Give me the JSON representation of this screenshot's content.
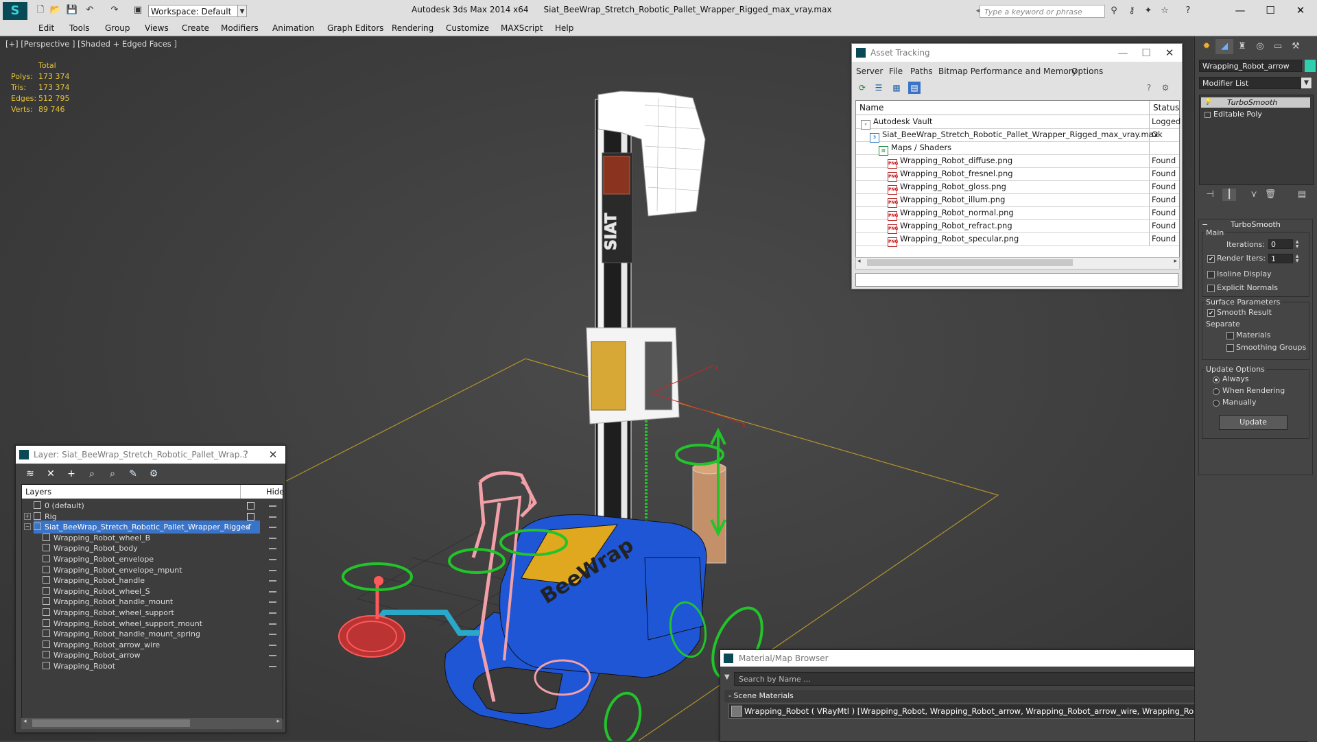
{
  "titlebar": {
    "app_name": "Autodesk 3ds Max  2014 x64",
    "file_name": "Siat_BeeWrap_Stretch_Robotic_Pallet_Wrapper_Rigged_max_vray.max",
    "workspace": "Workspace: Default",
    "search_placeholder": "Type a keyword or phrase",
    "minimize": "—",
    "maximize": "☐",
    "close": "✕"
  },
  "menu": [
    "Edit",
    "Tools",
    "Group",
    "Views",
    "Create",
    "Modifiers",
    "Animation",
    "Graph Editors",
    "Rendering",
    "Customize",
    "MAXScript",
    "Help"
  ],
  "viewport": {
    "label": "[+] [Perspective ] [Shaded + Edged Faces ]",
    "stats_header": "Total",
    "stats": [
      {
        "k": "Polys:",
        "v": "173 374"
      },
      {
        "k": "Tris:",
        "v": "173 374"
      },
      {
        "k": "Edges:",
        "v": "512 795"
      },
      {
        "k": "Verts:",
        "v": "89 746"
      }
    ],
    "brand_text": "BeeWrap",
    "brand_text_2": "SIAT",
    "axis_x": "x",
    "axis_y": "y"
  },
  "asset_tracking": {
    "title": "Asset Tracking",
    "menu": [
      "Server",
      "File",
      "Paths",
      "Bitmap Performance and Memory",
      "Options"
    ],
    "col_name": "Name",
    "col_status": "Status",
    "rows": [
      {
        "name": "Autodesk Vault",
        "status": "Logged",
        "indent": 1,
        "icon": "vault-icon"
      },
      {
        "name": "Siat_BeeWrap_Stretch_Robotic_Pallet_Wrapper_Rigged_max_vray.max",
        "status": "Ok",
        "indent": 2,
        "icon": "max-file-icon"
      },
      {
        "name": "Maps / Shaders",
        "status": "",
        "indent": 3,
        "icon": "maps-icon"
      },
      {
        "name": "Wrapping_Robot_diffuse.png",
        "status": "Found",
        "indent": 4,
        "icon": "png-icon"
      },
      {
        "name": "Wrapping_Robot_fresnel.png",
        "status": "Found",
        "indent": 4,
        "icon": "png-icon"
      },
      {
        "name": "Wrapping_Robot_gloss.png",
        "status": "Found",
        "indent": 4,
        "icon": "png-icon"
      },
      {
        "name": "Wrapping_Robot_illum.png",
        "status": "Found",
        "indent": 4,
        "icon": "png-icon"
      },
      {
        "name": "Wrapping_Robot_normal.png",
        "status": "Found",
        "indent": 4,
        "icon": "png-icon"
      },
      {
        "name": "Wrapping_Robot_refract.png",
        "status": "Found",
        "indent": 4,
        "icon": "png-icon"
      },
      {
        "name": "Wrapping_Robot_specular.png",
        "status": "Found",
        "indent": 4,
        "icon": "png-icon"
      }
    ],
    "png_badge": "PNG"
  },
  "layer_explorer": {
    "title": "Layer: Siat_BeeWrap_Stretch_Robotic_Pallet_Wrap...",
    "help": "?",
    "col_layers": "Layers",
    "col_hide": "Hide",
    "rows": [
      {
        "name": "0 (default)",
        "level": 0,
        "expander": "",
        "box": true,
        "selected": false
      },
      {
        "name": "Rig",
        "level": 0,
        "expander": "+",
        "box": true,
        "selected": false
      },
      {
        "name": "Siat_BeeWrap_Stretch_Robotic_Pallet_Wrapper_Rigged",
        "level": 0,
        "expander": "−",
        "box": false,
        "selected": true
      },
      {
        "name": "Wrapping_Robot_wheel_B",
        "level": 1
      },
      {
        "name": "Wrapping_Robot_body",
        "level": 1
      },
      {
        "name": "Wrapping_Robot_envelope",
        "level": 1
      },
      {
        "name": "Wrapping_Robot_envelope_mpunt",
        "level": 1
      },
      {
        "name": "Wrapping_Robot_handle",
        "level": 1
      },
      {
        "name": "Wrapping_Robot_wheel_S",
        "level": 1
      },
      {
        "name": "Wrapping_Robot_handle_mount",
        "level": 1
      },
      {
        "name": "Wrapping_Robot_wheel_support",
        "level": 1
      },
      {
        "name": "Wrapping_Robot_wheel_support_mount",
        "level": 1
      },
      {
        "name": "Wrapping_Robot_handle_mount_spring",
        "level": 1
      },
      {
        "name": "Wrapping_Robot_arrow_wire",
        "level": 1
      },
      {
        "name": "Wrapping_Robot_arrow",
        "level": 1
      },
      {
        "name": "Wrapping_Robot",
        "level": 1
      }
    ],
    "active_check": "✓"
  },
  "material_browser": {
    "title": "Material/Map Browser",
    "search_placeholder": "Search by Name ...",
    "section": "- Scene Materials",
    "item": "Wrapping_Robot ( VRayMtl ) [Wrapping_Robot, Wrapping_Robot_arrow, Wrapping_Robot_arrow_wire, Wrapping_Robot_body, Wrapping_Robot_envelope,..."
  },
  "command_panel": {
    "object_name": "Wrapping_Robot_arrow",
    "object_color": "#2fcfae",
    "modifier_list": "Modifier List",
    "stack": [
      {
        "name": "TurboSmooth",
        "active": true
      },
      {
        "name": "Editable Poly",
        "active": false
      }
    ],
    "turbosmooth": {
      "title": "TurboSmooth",
      "main": "Main",
      "iterations_label": "Iterations:",
      "iterations": "0",
      "render_iters_label": "Render Iters:",
      "render_iters": "1",
      "render_iters_checked": true,
      "isoline": "Isoline Display",
      "explicit_normals": "Explicit Normals",
      "surface_params": "Surface Parameters",
      "smooth_result": "Smooth Result",
      "separate": "Separate",
      "materials": "Materials",
      "smoothing_groups": "Smoothing Groups",
      "update_options": "Update Options",
      "always": "Always",
      "when_rendering": "When Rendering",
      "manually": "Manually",
      "update": "Update"
    }
  },
  "colors": {
    "wire_blue": "#1f56d6",
    "wire_yellow": "#e0a81e",
    "wire_green": "#22c42a",
    "wire_pink": "#f2a0a8",
    "wire_red": "#ff5a5a",
    "wire_white": "#f0f0f0",
    "grid_orange": "#c9a227",
    "selection_blue": "#3a74c9"
  }
}
